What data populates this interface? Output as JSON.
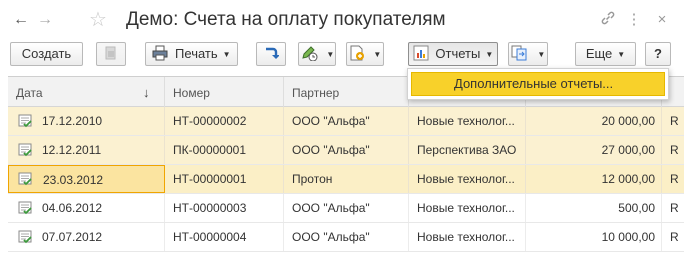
{
  "window": {
    "title": "Демо: Счета на оплату покупателям"
  },
  "toolbar": {
    "create": "Создать",
    "print": "Печать",
    "reports": "Отчеты",
    "more": "Еще",
    "help": "?"
  },
  "reports_menu": {
    "items": [
      "Дополнительные отчеты..."
    ]
  },
  "table": {
    "columns": [
      "Дата",
      "Номер",
      "Партнер",
      "",
      "",
      ""
    ],
    "sort_indicator": "↓",
    "rows": [
      {
        "date": "17.12.2010",
        "number": "НТ-00000002",
        "partner": "ООО \"Альфа\"",
        "counterparty": "Новые технолог...",
        "amount": "20 000,00",
        "currency": "R"
      },
      {
        "date": "12.12.2011",
        "number": "ПК-00000001",
        "partner": "ООО \"Альфа\"",
        "counterparty": "Перспектива ЗАО",
        "amount": "27 000,00",
        "currency": "R"
      },
      {
        "date": "23.03.2012",
        "number": "НТ-00000001",
        "partner": "Протон",
        "counterparty": "Новые технолог...",
        "amount": "12 000,00",
        "currency": "R"
      },
      {
        "date": "04.06.2012",
        "number": "НТ-00000003",
        "partner": "ООО \"Альфа\"",
        "counterparty": "Новые технолог...",
        "amount": "500,00",
        "currency": "R"
      },
      {
        "date": "07.07.2012",
        "number": "НТ-00000004",
        "partner": "ООО \"Альфа\"",
        "counterparty": "Новые технолог...",
        "amount": "10 000,00",
        "currency": "R"
      }
    ]
  },
  "colors": {
    "accent": "#f8d12a",
    "row_highlight": "#fbf1d1",
    "doc_icon_green": "#4caf50"
  },
  "icons": {
    "back": "arrow-left-icon",
    "forward": "arrow-right-icon",
    "favorite": "star-icon",
    "link": "link-icon",
    "menu": "more-vertical-icon",
    "close": "close-icon"
  }
}
